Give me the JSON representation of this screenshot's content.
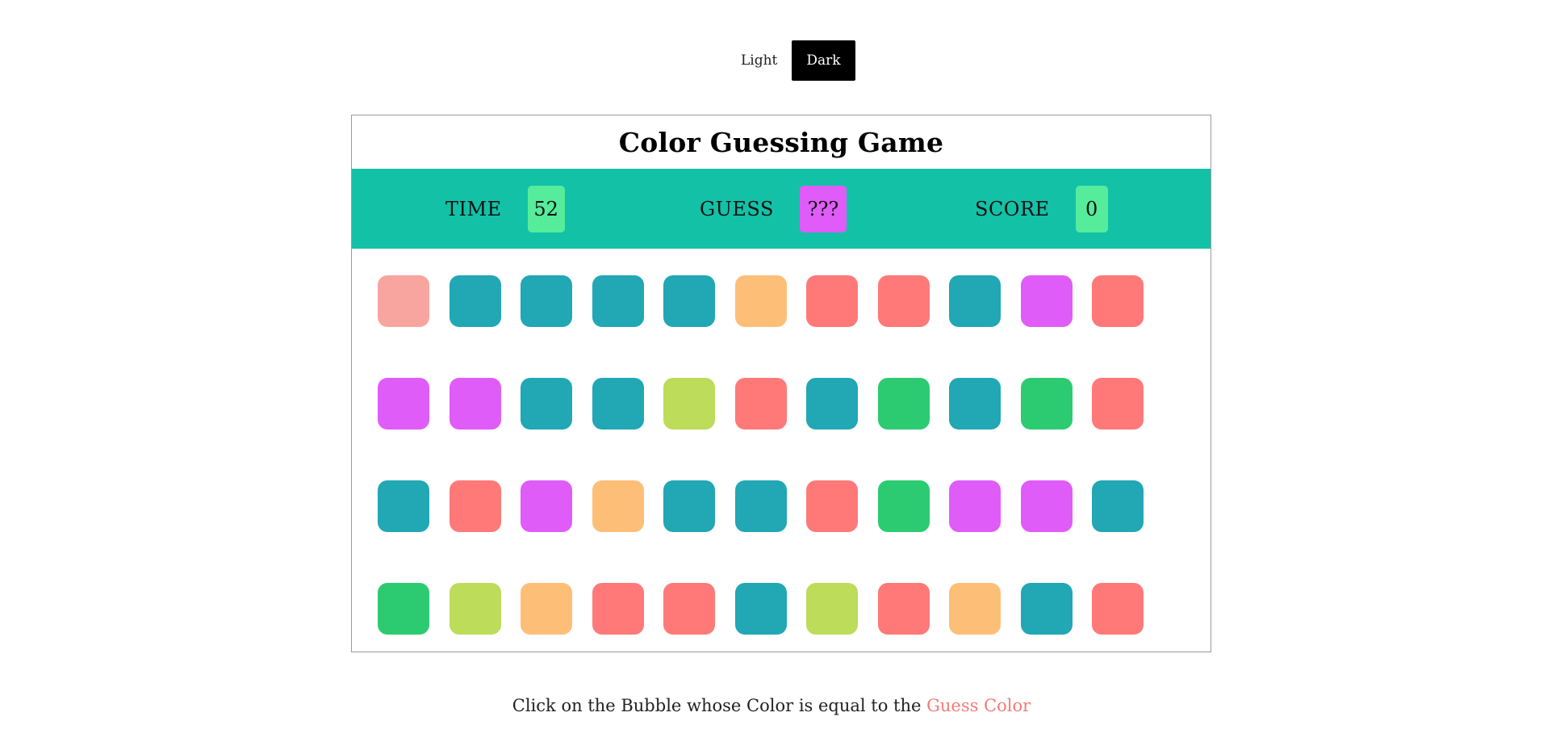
{
  "theme": {
    "light_label": "Light",
    "dark_label": "Dark",
    "active": "Dark"
  },
  "game": {
    "title": "Color Guessing Game",
    "time_label": "TIME",
    "time_value": "52",
    "guess_label": "GUESS",
    "guess_value": "???",
    "score_label": "SCORE",
    "score_value": "0"
  },
  "colors": {
    "bar": "#13c1a7",
    "time_box": "#55ec9b",
    "guess_box": "#e05cf8",
    "score_box": "#55ec9b",
    "accent": "#f07b78"
  },
  "bubbles": [
    [
      "#f8a5a0",
      "#22a7b4",
      "#22a7b4",
      "#22a7b4",
      "#22a7b4",
      "#fdbf77",
      "#ff7979",
      "#ff7979",
      "#22a7b4",
      "#e05cf8",
      "#ff7979"
    ],
    [
      "#e05cf8",
      "#e05cf8",
      "#22a7b4",
      "#22a7b4",
      "#bcdc5a",
      "#ff7979",
      "#22a7b4",
      "#2dcb71",
      "#22a7b4",
      "#2dcb71",
      "#ff7979"
    ],
    [
      "#22a7b4",
      "#ff7979",
      "#e05cf8",
      "#fdbf77",
      "#22a7b4",
      "#22a7b4",
      "#ff7979",
      "#2dcb71",
      "#e05cf8",
      "#e05cf8",
      "#22a7b4"
    ],
    [
      "#2dcb71",
      "#bcdc5a",
      "#fdbf77",
      "#ff7979",
      "#ff7979",
      "#22a7b4",
      "#bcdc5a",
      "#ff7979",
      "#fdbf77",
      "#22a7b4",
      "#ff7979"
    ]
  ],
  "instruction": {
    "text": "Click on the Bubble whose Color is equal to the ",
    "highlight": "Guess Color"
  }
}
